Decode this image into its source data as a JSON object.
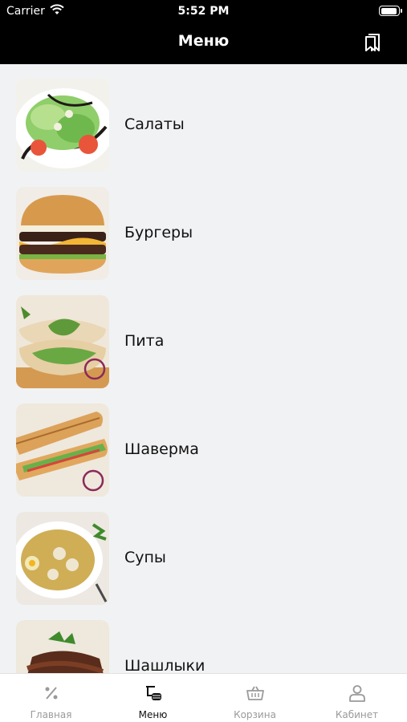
{
  "status_bar": {
    "carrier": "Carrier",
    "time": "5:52 PM"
  },
  "header": {
    "title": "Меню"
  },
  "categories": [
    {
      "label": "Салаты"
    },
    {
      "label": "Бургеры"
    },
    {
      "label": "Пита"
    },
    {
      "label": "Шаверма"
    },
    {
      "label": "Супы"
    },
    {
      "label": "Шашлыки"
    }
  ],
  "tabbar": {
    "items": [
      {
        "label": "Главная",
        "icon": "discount-icon"
      },
      {
        "label": "Меню",
        "icon": "menu-food-icon",
        "active": true
      },
      {
        "label": "Корзина",
        "icon": "basket-icon"
      },
      {
        "label": "Кабинет",
        "icon": "profile-icon"
      }
    ]
  },
  "colors": {
    "header_bg": "#000000",
    "page_bg": "#f1f2f4",
    "tab_active": "#111111",
    "tab_inactive": "#9a9a9a"
  }
}
